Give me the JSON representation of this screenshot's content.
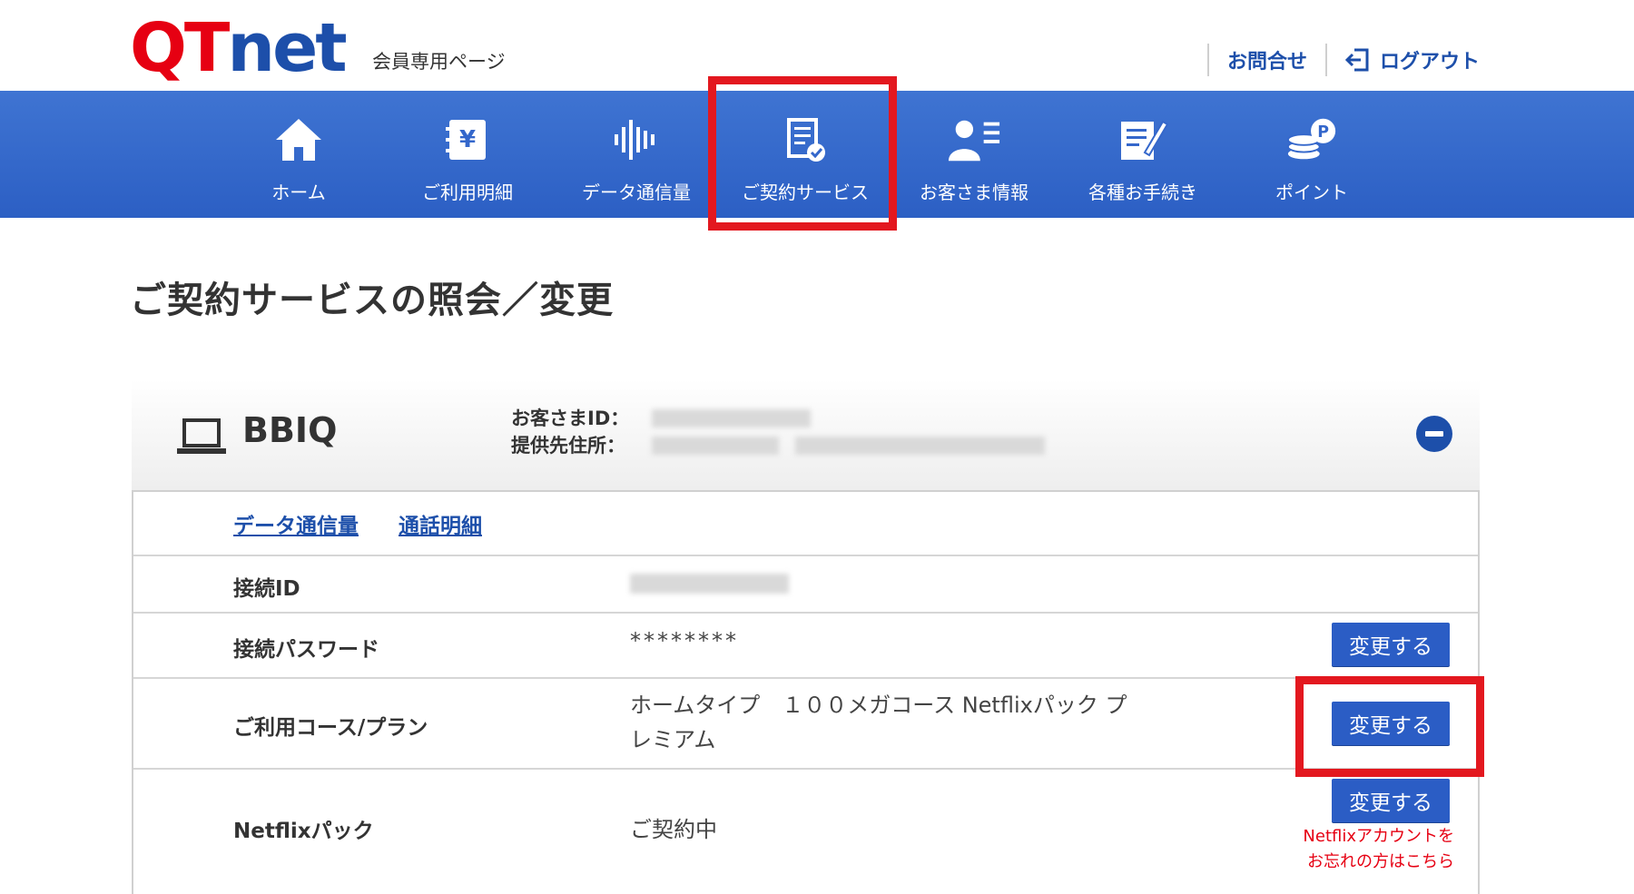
{
  "header": {
    "logo_qt": "QT",
    "logo_net": "net",
    "subtitle": "会員専用ページ",
    "contact_label": "お問合せ",
    "logout_label": "ログアウト"
  },
  "nav": {
    "items": [
      {
        "label": "ホーム",
        "icon": "home-icon"
      },
      {
        "label": "ご利用明細",
        "icon": "billing-icon"
      },
      {
        "label": "データ通信量",
        "icon": "data-usage-icon"
      },
      {
        "label": "ご契約サービス",
        "icon": "contract-service-icon",
        "highlighted": true
      },
      {
        "label": "お客さま情報",
        "icon": "customer-info-icon"
      },
      {
        "label": "各種お手続き",
        "icon": "procedures-icon"
      },
      {
        "label": "ポイント",
        "icon": "points-icon"
      }
    ]
  },
  "page": {
    "title": "ご契約サービスの照会／変更"
  },
  "service": {
    "name": "BBIQ",
    "icon": "laptop-icon",
    "customer_id_label": "お客さまID：",
    "address_label": "提供先住所：",
    "links": {
      "data_usage": "データ通信量",
      "call_details": "通話明細"
    },
    "rows": {
      "connection_id": {
        "label": "接続ID"
      },
      "password": {
        "label": "接続パスワード",
        "value": "********",
        "button": "変更する"
      },
      "course": {
        "label": "ご利用コース/プラン",
        "value_line1": "ホームタイプ　１００メガコース Netflixパック プ",
        "value_line2": "レミアム",
        "button": "変更する"
      },
      "netflix": {
        "label": "Netflixパック",
        "value": "ご契約中",
        "button": "変更する",
        "note_line1": "Netflixアカウントを",
        "note_line2": "お忘れの方はこちら"
      }
    }
  },
  "colors": {
    "brand_red": "#e60012",
    "brand_blue": "#1d4faa",
    "nav_blue": "#3467cb",
    "highlight_red": "#e3181f"
  }
}
